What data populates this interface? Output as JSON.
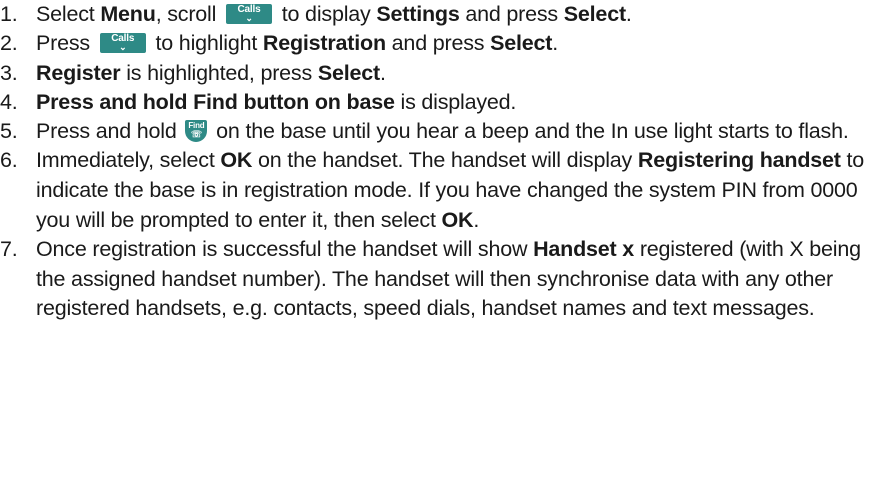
{
  "icons": {
    "calls_key": {
      "name": "calls-scroll-down-key-icon",
      "label": "Calls",
      "glyph": "⌄",
      "color": "#2e8a86"
    },
    "find_key": {
      "name": "find-button-icon",
      "label": "Find",
      "glyph": "☏",
      "color": "#2e8a86"
    }
  },
  "steps": [
    {
      "num": "1.",
      "t1": "Select ",
      "b1": "Menu",
      "t2": ", scroll ",
      "t3": " to display ",
      "b2": "Settings",
      "t4": " and press ",
      "b3": "Select",
      "t5": "."
    },
    {
      "num": "2.",
      "t1": "Press ",
      "t2": " to highlight ",
      "b1": "Registration",
      "t3": " and press ",
      "b2": "Select",
      "t4": "."
    },
    {
      "num": "3.",
      "b1": "Register",
      "t1": " is highlighted, press ",
      "b2": "Select",
      "t2": "."
    },
    {
      "num": "4.",
      "b1": "Press and hold Find button on base",
      "t1": " is displayed."
    },
    {
      "num": "5.",
      "t1": "Press and hold ",
      "t2": " on the base until you hear a beep and the In use light starts to flash."
    },
    {
      "num": "6.",
      "t1": "Immediately, select ",
      "b1": "OK",
      "t2": " on the handset. The handset will display ",
      "b2": "Registering handset",
      "t3": " to indicate the base is in registration mode. If you have changed the system PIN from 0000 you will be prompted to enter it, then select ",
      "b3": "OK",
      "t4": "."
    },
    {
      "num": "7.",
      "t1": "Once registration is successful the handset will show ",
      "b1": "Handset x",
      "t2": " registered (with X being the assigned handset number). The handset will then synchronise data with any other registered handsets, e.g. contacts, speed dials, handset names and text messages."
    }
  ]
}
